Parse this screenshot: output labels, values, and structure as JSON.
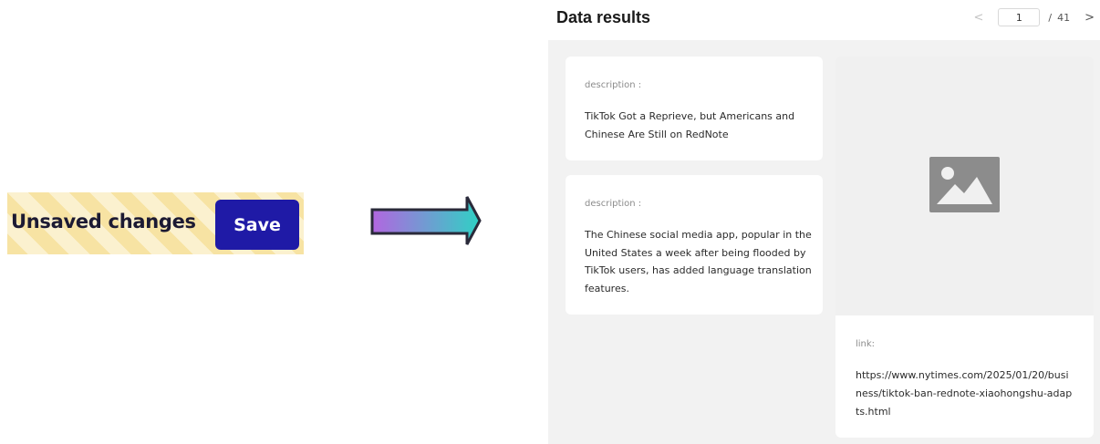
{
  "unsaved": {
    "message": "Unsaved changes",
    "save_label": "Save"
  },
  "panel": {
    "title": "Data results",
    "pager": {
      "prev_icon": "chevron-left",
      "current_page": "1",
      "separator": "/",
      "total_pages": "41",
      "next_icon": "chevron-right"
    },
    "cards": [
      {
        "label": "description :",
        "text": "TikTok Got a Reprieve, but Americans and Chinese Are Still on RedNote"
      },
      {
        "label": "description :",
        "text": "The Chinese social media app, popular in the United States a week after being flooded by TikTok users, has added language translation features."
      }
    ],
    "image_placeholder_icon": "image-icon",
    "link": {
      "label": "link:",
      "url": "https://www.nytimes.com/2025/01/20/business/tiktok-ban-rednote-xiaohongshu-adapts.html"
    }
  },
  "colors": {
    "save_button": "#1f1aa6",
    "stripe_light": "#fbf1cf",
    "stripe_dark": "#f7e3a3",
    "arrow_start": "#b266e0",
    "arrow_end": "#2fd1c4",
    "panel_bg": "#f2f2f2"
  }
}
